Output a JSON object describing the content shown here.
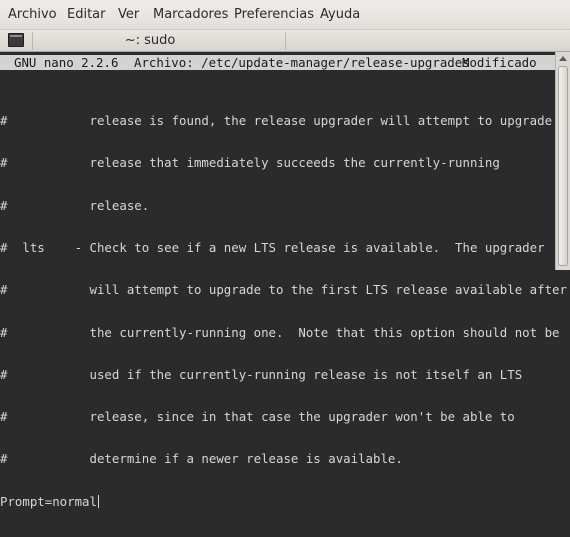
{
  "menubar": {
    "items": [
      "Archivo",
      "Editar",
      "Ver",
      "Marcadores",
      "Preferencias",
      "Ayuda"
    ]
  },
  "tabbar": {
    "title": "~: sudo",
    "icon": "terminal-icon"
  },
  "nano": {
    "version": "GNU nano 2.2.6",
    "file_label": "Archivo: /etc/update-manager/release-upgrades",
    "status": "Modificado"
  },
  "terminal": {
    "lines": [
      "#           release is found, the release upgrader will attempt to upgrade to",
      "#           release that immediately succeeds the currently-running",
      "#           release.",
      "#  lts    - Check to see if a new LTS release is available.  The upgrader",
      "#           will attempt to upgrade to the first LTS release available after",
      "#           the currently-running one.  Note that this option should not be",
      "#           used if the currently-running release is not itself an LTS",
      "#           release, since in that case the upgrader won't be able to",
      "#           determine if a newer release is available.",
      "Prompt=normal"
    ]
  },
  "colors": {
    "terminal_bg": "#2b2b2b",
    "terminal_fg": "#d6d6d6",
    "header_bg": "#d3d3d3"
  }
}
